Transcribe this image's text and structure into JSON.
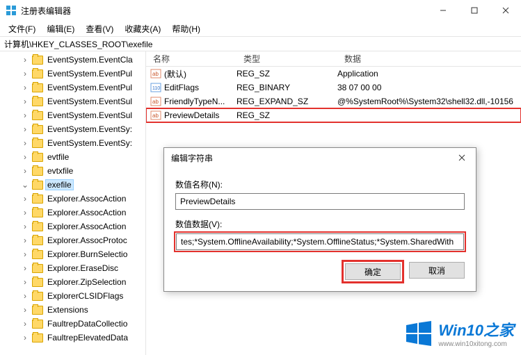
{
  "window": {
    "title": "注册表编辑器",
    "menu": {
      "file": "文件(F)",
      "edit": "编辑(E)",
      "view": "查看(V)",
      "fav": "收藏夹(A)",
      "help": "帮助(H)"
    },
    "address": "计算机\\HKEY_CLASSES_ROOT\\exefile"
  },
  "tree": {
    "items": [
      {
        "label": "EventSystem.EventCla"
      },
      {
        "label": "EventSystem.EventPul"
      },
      {
        "label": "EventSystem.EventPul"
      },
      {
        "label": "EventSystem.EventSul"
      },
      {
        "label": "EventSystem.EventSul"
      },
      {
        "label": "EventSystem.EventSy:"
      },
      {
        "label": "EventSystem.EventSy:"
      },
      {
        "label": "evtfile"
      },
      {
        "label": "evtxfile"
      },
      {
        "label": "exefile",
        "selected": true
      },
      {
        "label": "Explorer.AssocAction"
      },
      {
        "label": "Explorer.AssocAction"
      },
      {
        "label": "Explorer.AssocAction"
      },
      {
        "label": "Explorer.AssocProtoc"
      },
      {
        "label": "Explorer.BurnSelectio"
      },
      {
        "label": "Explorer.EraseDisc"
      },
      {
        "label": "Explorer.ZipSelection"
      },
      {
        "label": "ExplorerCLSIDFlags"
      },
      {
        "label": "Extensions"
      },
      {
        "label": "FaultrepDataCollectio"
      },
      {
        "label": "FaultrepElevatedData"
      }
    ]
  },
  "list": {
    "headers": {
      "name": "名称",
      "type": "类型",
      "data": "数据"
    },
    "rows": [
      {
        "name": "(默认)",
        "type": "REG_SZ",
        "data": "Application",
        "kind": "str"
      },
      {
        "name": "EditFlags",
        "type": "REG_BINARY",
        "data": "38 07 00 00",
        "kind": "bin"
      },
      {
        "name": "FriendlyTypeN...",
        "type": "REG_EXPAND_SZ",
        "data": "@%SystemRoot%\\System32\\shell32.dll,-10156",
        "kind": "str"
      },
      {
        "name": "PreviewDetails",
        "type": "REG_SZ",
        "data": "",
        "kind": "str",
        "highlight": true
      }
    ]
  },
  "dialog": {
    "title": "编辑字符串",
    "name_label": "数值名称(N):",
    "name_value": "PreviewDetails",
    "data_label": "数值数据(V):",
    "data_value": "tes;*System.OfflineAvailability;*System.OfflineStatus;*System.SharedWith",
    "ok": "确定",
    "cancel": "取消"
  },
  "watermark": {
    "brand": "Win10之家",
    "url": "www.win10xitong.com"
  }
}
